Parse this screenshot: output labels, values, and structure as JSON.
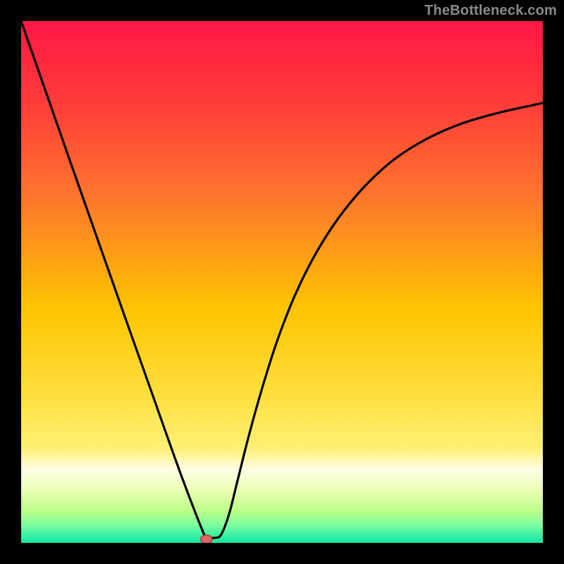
{
  "attribution": "TheBottleneck.com",
  "colors": {
    "frame": "#000000",
    "curve": "#000000",
    "marker_fill": "#e06666",
    "marker_stroke": "#b53a3a",
    "gradient_stops": [
      {
        "offset": 0.0,
        "color": "#ff1744"
      },
      {
        "offset": 0.15,
        "color": "#ff3a3a"
      },
      {
        "offset": 0.35,
        "color": "#ff7a2a"
      },
      {
        "offset": 0.55,
        "color": "#ffc400"
      },
      {
        "offset": 0.72,
        "color": "#ffe040"
      },
      {
        "offset": 0.82,
        "color": "#fff176"
      },
      {
        "offset": 0.86,
        "color": "#fffde7"
      },
      {
        "offset": 0.9,
        "color": "#e9ffb0"
      },
      {
        "offset": 0.94,
        "color": "#b9ff8a"
      },
      {
        "offset": 0.965,
        "color": "#80ff9f"
      },
      {
        "offset": 0.985,
        "color": "#3bf0a3"
      },
      {
        "offset": 1.0,
        "color": "#14e8a0"
      }
    ]
  },
  "chart_data": {
    "type": "line",
    "title": "",
    "xlabel": "",
    "ylabel": "",
    "xlim": [
      0,
      1
    ],
    "ylim": [
      0,
      1
    ],
    "grid": false,
    "legend": false,
    "series": [
      {
        "name": "bottleneck-curve",
        "x": [
          0.0,
          0.05,
          0.1,
          0.15,
          0.2,
          0.25,
          0.28,
          0.3,
          0.32,
          0.335,
          0.345,
          0.352,
          0.36,
          0.375,
          0.382,
          0.39,
          0.4,
          0.415,
          0.435,
          0.46,
          0.49,
          0.525,
          0.565,
          0.61,
          0.66,
          0.715,
          0.775,
          0.84,
          0.91,
          0.985,
          1.0
        ],
        "y": [
          1.0,
          0.857,
          0.714,
          0.572,
          0.43,
          0.289,
          0.204,
          0.148,
          0.094,
          0.055,
          0.03,
          0.014,
          0.01,
          0.01,
          0.014,
          0.03,
          0.06,
          0.12,
          0.2,
          0.29,
          0.385,
          0.475,
          0.555,
          0.625,
          0.685,
          0.735,
          0.773,
          0.802,
          0.823,
          0.84,
          0.843
        ]
      }
    ],
    "marker": {
      "x": 0.355,
      "y": 0.007
    }
  }
}
